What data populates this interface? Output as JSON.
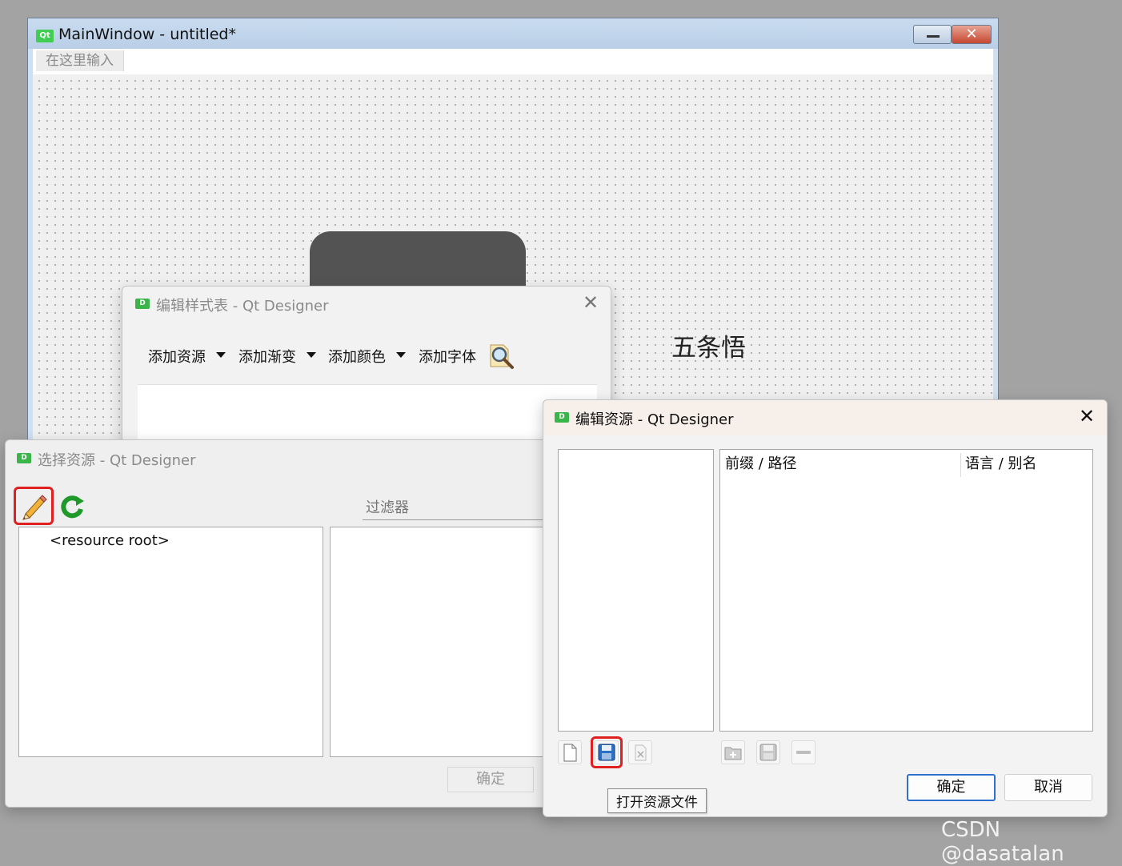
{
  "main_window": {
    "title": "MainWindow - untitled*",
    "logo_text": "Qt",
    "menu_placeholder": "在这里输入",
    "canvas_label": "五条悟",
    "minimize_glyph": "",
    "close_glyph": "✕"
  },
  "style_dialog": {
    "title": "编辑样式表 - Qt Designer",
    "close_glyph": "✕",
    "toolbar": [
      "添加资源",
      "添加渐变",
      "添加颜色",
      "添加字体"
    ],
    "icons": [
      "magnifier-icon"
    ]
  },
  "select_dialog": {
    "title": "选择资源 - Qt Designer",
    "filter_placeholder": "过滤器",
    "tree_root": "<resource root>",
    "ok_label": "确定",
    "icons": [
      "pencil-icon",
      "refresh-icon"
    ]
  },
  "edit_dialog": {
    "title": "编辑资源 - Qt Designer",
    "close_glyph": "✕",
    "col_prefix": "前缀 / 路径",
    "col_lang": "语言 / 别名",
    "ok_label": "确定",
    "cancel_label": "取消",
    "tooltip": "打开资源文件",
    "icons": [
      "new-file-icon",
      "open-file-icon",
      "remove-file-icon",
      "add-folder-icon",
      "add-files-icon",
      "remove-icon"
    ]
  },
  "dialog_icon_text": "D",
  "watermark": "CSDN @dasatalan",
  "colors": {
    "highlight": "#e02020",
    "accent": "#2f6fd1",
    "qt_green": "#41cd52"
  }
}
